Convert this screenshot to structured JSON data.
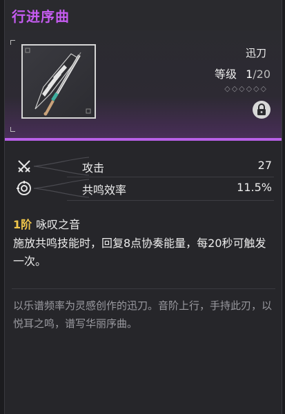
{
  "title": "行进序曲",
  "weapon": {
    "name": "迅刀",
    "level_label": "等级",
    "level_current": "1",
    "level_max": "/20",
    "stars": "◇◇◇◇◇◇"
  },
  "stats": [
    {
      "icon": "crossed-swords-icon",
      "label": "攻击",
      "value": "27"
    },
    {
      "icon": "resonance-target-icon",
      "label": "共鸣效率",
      "value": "11.5%"
    }
  ],
  "passive": {
    "rank": "1阶",
    "name": "咏叹之音",
    "description": "施放共鸣技能时，回复8点协奏能量，每20秒可触发一次。"
  },
  "flavor_text": "以乐谱频率为灵感创作的迅刀。音阶上行，手持此刃，以悦耳之鸣，谱写华丽序曲。",
  "colors": {
    "title": "#c65cf2",
    "accent_bar": "#b960e8",
    "rank": "#f2c84b"
  }
}
